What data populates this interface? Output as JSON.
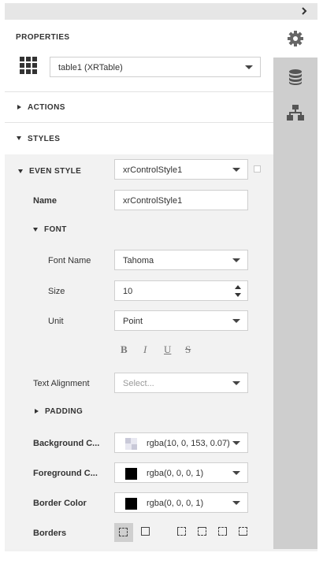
{
  "panel": {
    "title": "PROPERTIES",
    "selected_control": "table1 (XRTable)",
    "sections": {
      "actions": "ACTIONS",
      "styles": "STYLES"
    }
  },
  "even_style": {
    "label": "EVEN STYLE",
    "value": "xrControlStyle1",
    "name_label": "Name",
    "name_value": "xrControlStyle1"
  },
  "font": {
    "header": "FONT",
    "font_name_label": "Font Name",
    "font_name_value": "Tahoma",
    "size_label": "Size",
    "size_value": "10",
    "unit_label": "Unit",
    "unit_value": "Point",
    "bold": "B",
    "italic": "I",
    "underline": "U",
    "strikeout": "S"
  },
  "text_alignment": {
    "label": "Text Alignment",
    "placeholder": "Select..."
  },
  "padding": {
    "label": "PADDING"
  },
  "background_color": {
    "label": "Background C...",
    "value": "rgba(10, 0, 153, 0.07)"
  },
  "foreground_color": {
    "label": "Foreground C...",
    "value": "rgba(0, 0, 0, 1)"
  },
  "border_color": {
    "label": "Border Color",
    "value": "rgba(0, 0, 0, 1)"
  },
  "borders": {
    "label": "Borders"
  },
  "icons": {
    "collapse": "chevron-right-icon",
    "properties_tab": "gear-icon",
    "field_list_tab": "database-icon",
    "report_explorer_tab": "hierarchy-icon",
    "control_type": "table-grid-icon"
  },
  "colors": {
    "accent_gear": "#666666",
    "sidebar_bg": "#cecece",
    "section_bg": "#f2f2f2"
  }
}
